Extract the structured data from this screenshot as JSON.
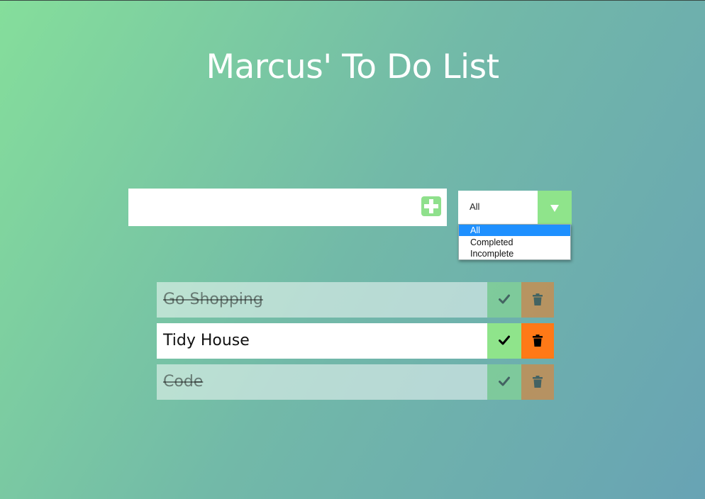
{
  "header": {
    "title": "Marcus' To Do List"
  },
  "form": {
    "input_value": "",
    "input_placeholder": "",
    "add_icon": "plus-icon"
  },
  "filter": {
    "selected": "All",
    "arrow_icon": "triangle-down-icon",
    "options": [
      "All",
      "Completed",
      "Incomplete"
    ],
    "highlighted_option": "All"
  },
  "todos": [
    {
      "text": "Go Shopping",
      "completed": true
    },
    {
      "text": "Tidy House",
      "completed": false
    },
    {
      "text": "Code",
      "completed": true
    }
  ],
  "icons": {
    "complete": "check-icon",
    "delete": "trash-icon"
  },
  "colors": {
    "gradient_start": "#85de9b",
    "gradient_end": "#68a3b4",
    "accent_green": "#8fe48b",
    "delete_orange": "#ff7917",
    "dropdown_highlight": "#1e90ff"
  }
}
